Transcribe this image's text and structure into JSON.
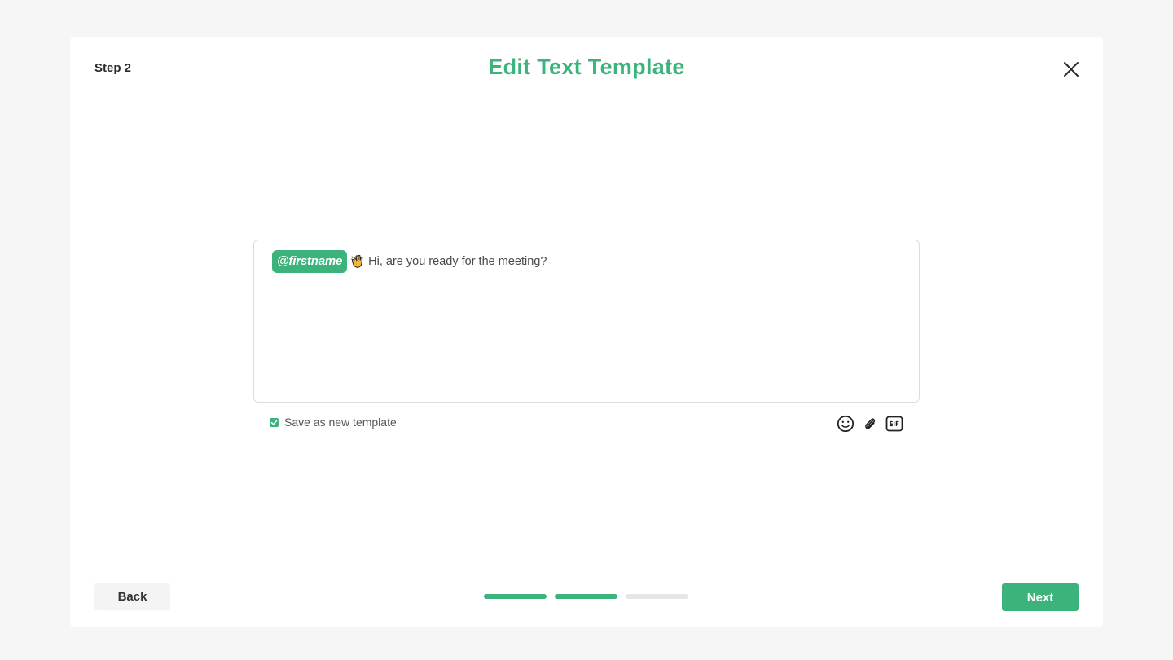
{
  "header": {
    "step_label": "Step 2",
    "title": "Edit Text Template",
    "close_icon": "close-icon"
  },
  "editor": {
    "tag_label": "@firstname",
    "emoji": "waving-hand-emoji",
    "message": "Hi, are you ready for the meeting?"
  },
  "options": {
    "save_template_checked": true,
    "save_template_label": "Save as new template",
    "tools": [
      "emoji-icon",
      "attachment-icon",
      "gif-icon"
    ]
  },
  "footer": {
    "back_label": "Back",
    "next_label": "Next",
    "progress": {
      "total_steps": 3,
      "completed_steps": 2
    }
  },
  "colors": {
    "accent": "#3bb37a",
    "background": "#f6f6f6",
    "surface": "#ffffff",
    "progress_inactive": "#e6e6e6"
  }
}
